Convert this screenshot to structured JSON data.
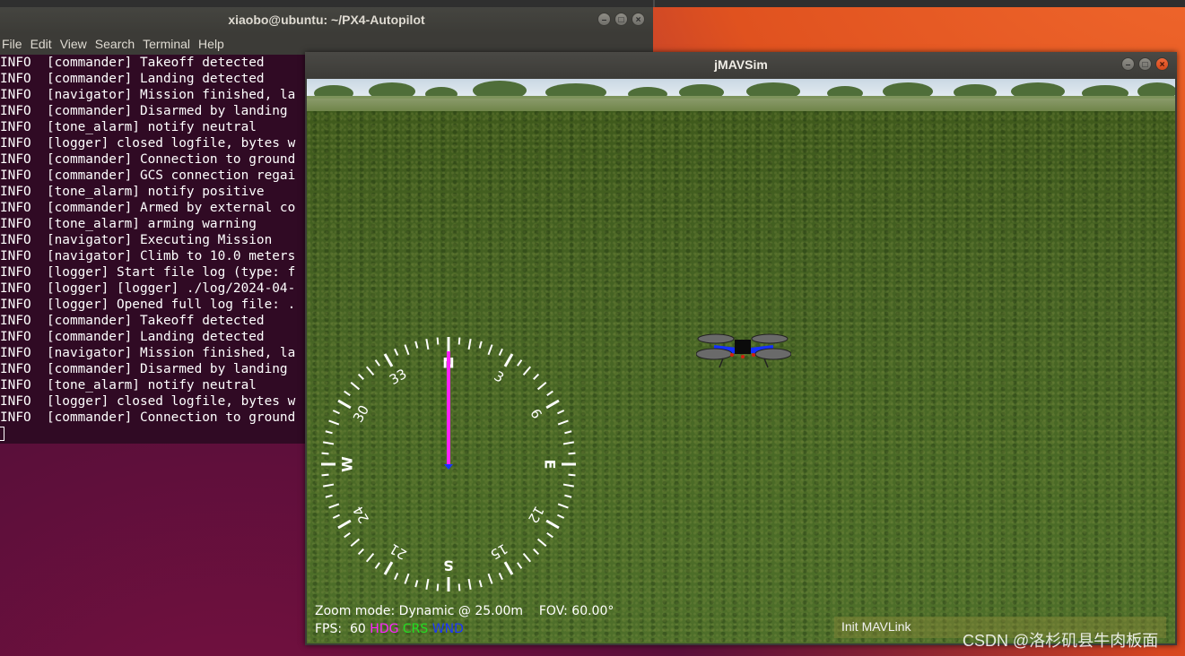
{
  "terminal": {
    "title": "xiaobo@ubuntu: ~/PX4-Autopilot",
    "menu": [
      "File",
      "Edit",
      "View",
      "Search",
      "Terminal",
      "Help"
    ],
    "lines": [
      "INFO  [commander] Takeoff detected",
      "INFO  [commander] Landing detected",
      "INFO  [navigator] Mission finished, la",
      "INFO  [commander] Disarmed by landing",
      "INFO  [tone_alarm] notify neutral",
      "INFO  [logger] closed logfile, bytes w",
      "INFO  [commander] Connection to ground",
      "INFO  [commander] GCS connection regai",
      "INFO  [tone_alarm] notify positive",
      "INFO  [commander] Armed by external co",
      "INFO  [tone_alarm] arming warning",
      "INFO  [navigator] Executing Mission",
      "INFO  [navigator] Climb to 10.0 meters",
      "INFO  [logger] Start file log (type: f",
      "INFO  [logger] [logger] ./log/2024-04-",
      "INFO  [logger] Opened full log file: .",
      "INFO  [commander] Takeoff detected",
      "INFO  [commander] Landing detected",
      "INFO  [navigator] Mission finished, la",
      "INFO  [commander] Disarmed by landing",
      "INFO  [tone_alarm] notify neutral",
      "INFO  [logger] closed logfile, bytes w",
      "INFO  [commander] Connection to ground"
    ]
  },
  "sim": {
    "title": "jMAVSim",
    "compass": {
      "cardinals": [
        "N",
        "E",
        "S",
        "W"
      ],
      "numbers": [
        "3",
        "6",
        "12",
        "15",
        "21",
        "24",
        "30",
        "33"
      ],
      "heading_deg": 0
    },
    "hud": {
      "zoom_label": "Zoom mode: Dynamic @ 25.00m",
      "fov_label": "FOV: 60.00°",
      "fps_label": "FPS:",
      "fps_value": "60",
      "hdg": "HDG",
      "crs": "CRS",
      "wnd": "WND"
    },
    "status": "Init MAVLink"
  },
  "watermark": "CSDN @洛杉矶县牛肉板面",
  "colors": {
    "terminal_bg": "#300a24",
    "hdg": "#ff22ff",
    "crs": "#22dd22",
    "wnd": "#1a33ff",
    "close_button": "#e95420"
  }
}
